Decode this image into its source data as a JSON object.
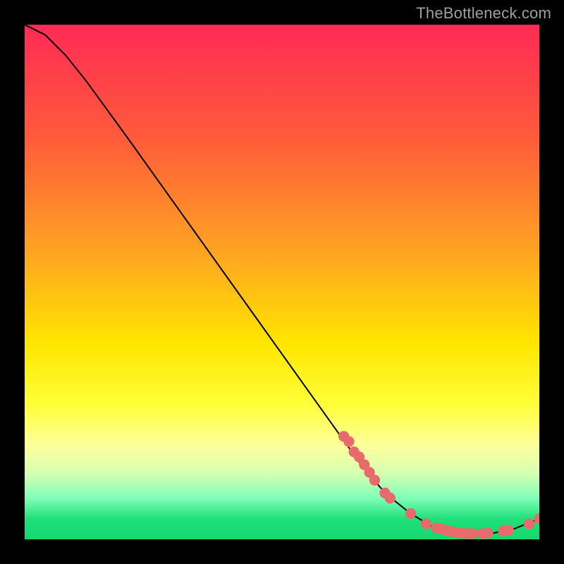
{
  "attribution": "TheBottleneck.com",
  "chart_data": {
    "type": "line",
    "title": "",
    "xlabel": "",
    "ylabel": "",
    "xlim": [
      0,
      100
    ],
    "ylim": [
      0,
      100
    ],
    "curve": [
      {
        "x": 0,
        "y": 100
      },
      {
        "x": 4,
        "y": 98
      },
      {
        "x": 8,
        "y": 94
      },
      {
        "x": 12,
        "y": 89
      },
      {
        "x": 20,
        "y": 78
      },
      {
        "x": 30,
        "y": 64
      },
      {
        "x": 40,
        "y": 50
      },
      {
        "x": 50,
        "y": 36
      },
      {
        "x": 60,
        "y": 22
      },
      {
        "x": 65,
        "y": 15
      },
      {
        "x": 70,
        "y": 9
      },
      {
        "x": 75,
        "y": 5
      },
      {
        "x": 80,
        "y": 2
      },
      {
        "x": 85,
        "y": 1
      },
      {
        "x": 90,
        "y": 1
      },
      {
        "x": 95,
        "y": 2
      },
      {
        "x": 100,
        "y": 4
      }
    ],
    "points": [
      {
        "x": 62,
        "y": 20
      },
      {
        "x": 63,
        "y": 19
      },
      {
        "x": 64,
        "y": 17
      },
      {
        "x": 65,
        "y": 16
      },
      {
        "x": 66,
        "y": 14.5
      },
      {
        "x": 67,
        "y": 13
      },
      {
        "x": 68,
        "y": 11.5
      },
      {
        "x": 70,
        "y": 9
      },
      {
        "x": 71,
        "y": 8
      },
      {
        "x": 75,
        "y": 5
      },
      {
        "x": 78,
        "y": 3
      },
      {
        "x": 80,
        "y": 2.2
      },
      {
        "x": 81,
        "y": 2
      },
      {
        "x": 82,
        "y": 1.7
      },
      {
        "x": 83,
        "y": 1.5
      },
      {
        "x": 84,
        "y": 1.3
      },
      {
        "x": 85,
        "y": 1.2
      },
      {
        "x": 86,
        "y": 1.1
      },
      {
        "x": 87,
        "y": 1.1
      },
      {
        "x": 89,
        "y": 1.1
      },
      {
        "x": 90,
        "y": 1.2
      },
      {
        "x": 93,
        "y": 1.6
      },
      {
        "x": 94,
        "y": 1.8
      },
      {
        "x": 98,
        "y": 3.0
      },
      {
        "x": 100,
        "y": 4.0
      }
    ],
    "point_color": "#e86a6a",
    "curve_color": "#000000"
  }
}
